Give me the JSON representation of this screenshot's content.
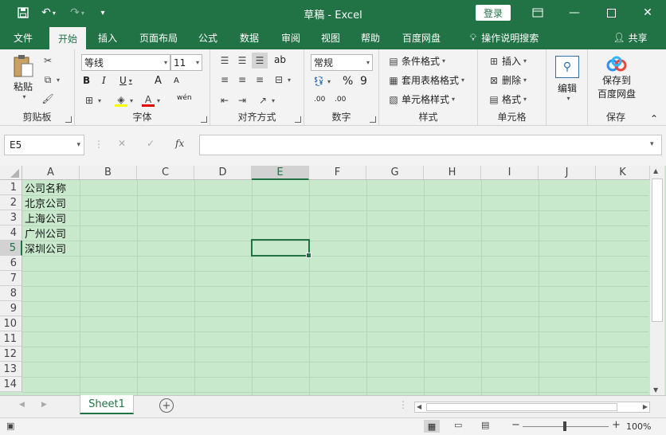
{
  "window": {
    "title": "草稿 - Excel",
    "login_label": "登录"
  },
  "tabs": [
    "文件",
    "开始",
    "插入",
    "页面布局",
    "公式",
    "数据",
    "审阅",
    "视图",
    "帮助",
    "百度网盘"
  ],
  "active_tab": "开始",
  "tell_me": "操作说明搜索",
  "share_label": "共享",
  "ribbon": {
    "clipboard": {
      "label": "剪贴板",
      "paste": "粘贴"
    },
    "font": {
      "label": "字体",
      "font_name": "等线",
      "font_size": "11",
      "bold": "B",
      "italic": "I",
      "underline": "U",
      "grow": "A",
      "shrink": "A",
      "phonetic": "wén"
    },
    "alignment": {
      "label": "对齐方式",
      "wrap": "ab"
    },
    "number": {
      "label": "数字",
      "format": "常规",
      "percent": "%",
      "comma": "9",
      "inc_dec": ".00",
      "dec_dec": ".00"
    },
    "styles": {
      "label": "样式",
      "conditional": "条件格式",
      "table": "套用表格格式",
      "cell_styles": "单元格样式"
    },
    "cells": {
      "label": "单元格",
      "insert": "插入",
      "delete": "删除",
      "format": "格式"
    },
    "editing": {
      "label": "编辑"
    },
    "save": {
      "label": "保存",
      "save_to": "保存到",
      "baidu": "百度网盘"
    }
  },
  "formula_bar": {
    "name_box": "E5",
    "cancel": "✕",
    "enter": "✓",
    "fx": "fx",
    "value": ""
  },
  "grid": {
    "columns": [
      "A",
      "B",
      "C",
      "D",
      "E",
      "F",
      "G",
      "H",
      "I",
      "J",
      "K"
    ],
    "rows": [
      "1",
      "2",
      "3",
      "4",
      "5",
      "6",
      "7",
      "8",
      "9",
      "10",
      "11",
      "12",
      "13",
      "14"
    ],
    "selected_column": "E",
    "selected_row": "5",
    "active_cell": "E5",
    "cells": {
      "A1": "公司名称",
      "A2": "北京公司",
      "A3": "上海公司",
      "A4": "广州公司",
      "A5": "深圳公司"
    },
    "background_color": "#c9e9cd"
  },
  "sheets": [
    "Sheet1"
  ],
  "active_sheet": "Sheet1",
  "status": {
    "zoom": "100%"
  },
  "colors": {
    "accent": "#217346",
    "cell_fill": "#c9e9cd"
  }
}
